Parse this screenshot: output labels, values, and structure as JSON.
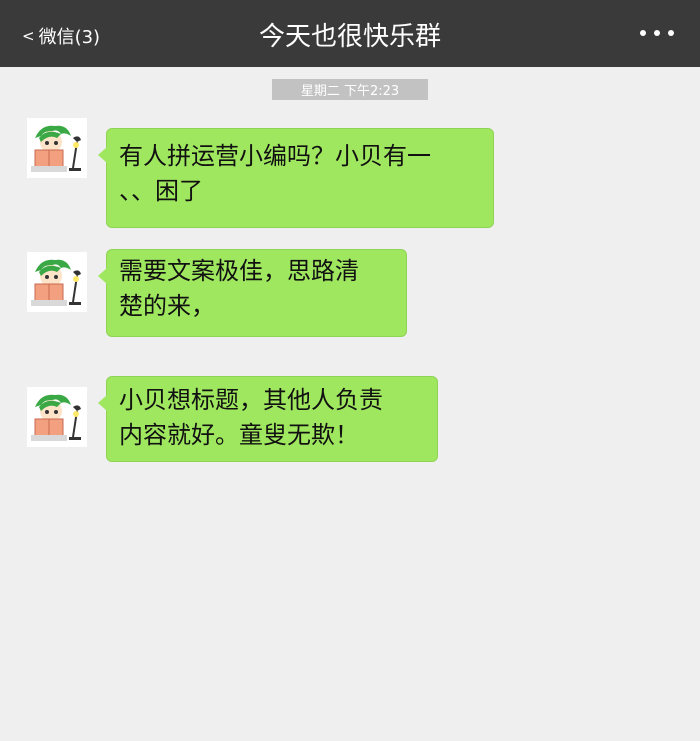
{
  "nav": {
    "back_label": "微信(3)",
    "title": "今天也很快乐群"
  },
  "timestamp": "星期二 下午2:23",
  "messages": [
    {
      "lines": [
        "有人拼运营小编吗？小贝有一",
        "、、困了"
      ]
    },
    {
      "lines": [
        "需要文案极佳，思路清",
        "楚的来，"
      ]
    },
    {
      "lines": [
        "小贝想标题，其他人负责",
        "内容就好。童叟无欺！"
      ]
    }
  ],
  "colors": {
    "nav_bg": "#3a3a3a",
    "bubble": "#9fe75f",
    "background": "#efefef"
  }
}
